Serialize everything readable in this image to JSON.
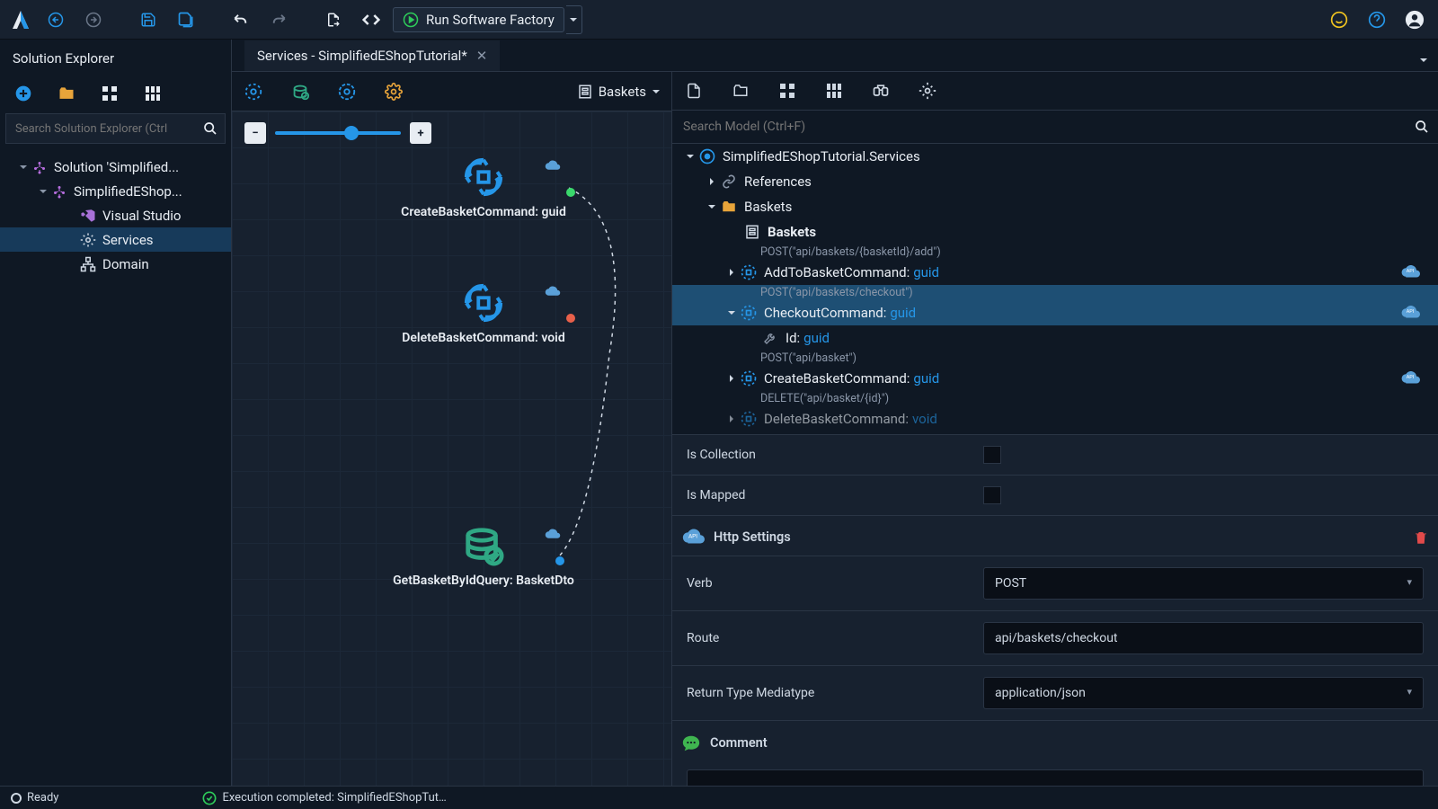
{
  "topbar": {
    "run_label": "Run Software Factory"
  },
  "sidebar": {
    "title": "Solution Explorer",
    "search_placeholder": "Search Solution Explorer (Ctrl",
    "tree": {
      "solution": "Solution 'Simplified...",
      "project": "SimplifiedEShop...",
      "items": [
        "Visual Studio",
        "Services",
        "Domain"
      ]
    }
  },
  "tab": {
    "title": "Services - SimplifiedEShopTutorial*"
  },
  "canvas": {
    "diagram_label": "Baskets",
    "nodes": [
      {
        "label": "CreateBasketCommand: guid"
      },
      {
        "label": "DeleteBasketCommand: void"
      },
      {
        "label": "GetBasketByIdQuery: BasketDto"
      }
    ]
  },
  "model": {
    "search_placeholder": "Search Model (Ctrl+F)",
    "root": "SimplifiedEShopTutorial.Services",
    "references": "References",
    "folder": "Baskets",
    "diagram": "Baskets",
    "items": [
      {
        "route": "POST(\"api/baskets/{basketId}/add\")",
        "name": "AddToBasketCommand:",
        "type": "guid"
      },
      {
        "route": "POST(\"api/baskets/checkout\")",
        "name": "CheckoutCommand:",
        "type": "guid"
      },
      {
        "route": "POST(\"api/basket\")",
        "name": "CreateBasketCommand:",
        "type": "guid"
      },
      {
        "route": "DELETE(\"api/basket/{id}\")",
        "name": "DeleteBasketCommand:",
        "type": "void"
      }
    ],
    "field": {
      "name": "Id:",
      "type": "guid"
    }
  },
  "props": {
    "is_collection": "Is Collection",
    "is_mapped": "Is Mapped",
    "http_settings": "Http Settings",
    "verb_label": "Verb",
    "verb_value": "POST",
    "route_label": "Route",
    "route_value": "api/baskets/checkout",
    "rtm_label": "Return Type Mediatype",
    "rtm_value": "application/json",
    "comment": "Comment"
  },
  "status": {
    "ready": "Ready",
    "exec": "Execution completed: SimplifiedEShopTut…"
  }
}
